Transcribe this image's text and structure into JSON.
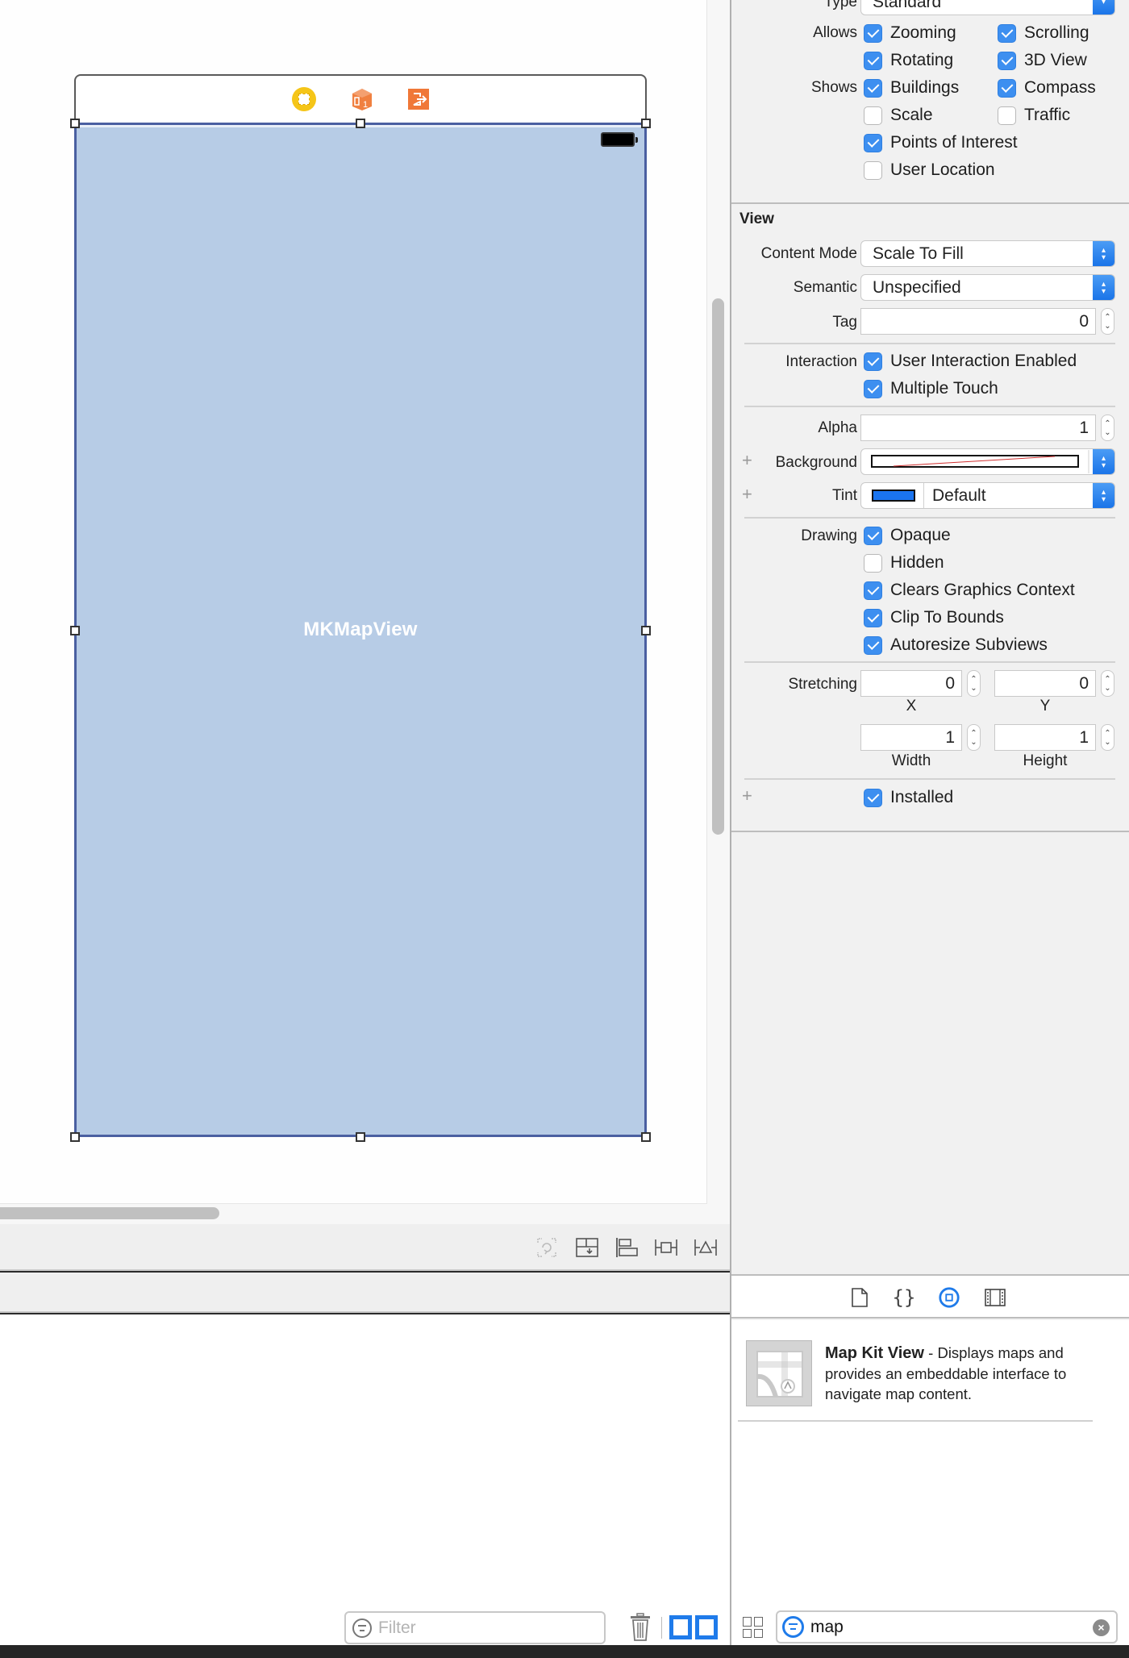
{
  "canvas": {
    "map_view_label": "MKMapView",
    "scene_icons": [
      "view-controller-icon",
      "first-responder-icon",
      "exit-icon"
    ],
    "map_fill_color": "#b7cce6",
    "selection_color": "#4a5fa1"
  },
  "canvas_toolbar": {
    "icons": [
      "update-frames-icon",
      "embed-in-stack-icon",
      "align-icon",
      "add-constraints-icon",
      "resolve-issues-icon"
    ]
  },
  "debug_bar": {
    "filter_placeholder": "Filter",
    "trash_icon": "trash-icon",
    "panel_toggles": [
      "show-variables-view",
      "show-console"
    ]
  },
  "inspector": {
    "map_view": {
      "type_label": "Type",
      "type_value": "Standard",
      "allows_label": "Allows",
      "shows_label": "Shows",
      "allows": [
        {
          "label": "Zooming",
          "checked": true
        },
        {
          "label": "Scrolling",
          "checked": true
        },
        {
          "label": "Rotating",
          "checked": true
        },
        {
          "label": "3D View",
          "checked": true
        }
      ],
      "shows": [
        {
          "label": "Buildings",
          "checked": true
        },
        {
          "label": "Compass",
          "checked": true
        },
        {
          "label": "Scale",
          "checked": false
        },
        {
          "label": "Traffic",
          "checked": false
        },
        {
          "label": "Points of Interest",
          "checked": true
        },
        {
          "label": "User Location",
          "checked": false
        }
      ]
    },
    "view": {
      "section_title": "View",
      "content_mode_label": "Content Mode",
      "content_mode_value": "Scale To Fill",
      "semantic_label": "Semantic",
      "semantic_value": "Unspecified",
      "tag_label": "Tag",
      "tag_value": "0",
      "interaction_label": "Interaction",
      "interaction": [
        {
          "label": "User Interaction Enabled",
          "checked": true
        },
        {
          "label": "Multiple Touch",
          "checked": true
        }
      ],
      "alpha_label": "Alpha",
      "alpha_value": "1",
      "background_label": "Background",
      "tint_label": "Tint",
      "tint_value": "Default",
      "tint_color": "#1a74f0",
      "drawing_label": "Drawing",
      "drawing": [
        {
          "label": "Opaque",
          "checked": true
        },
        {
          "label": "Hidden",
          "checked": false
        },
        {
          "label": "Clears Graphics Context",
          "checked": true
        },
        {
          "label": "Clip To Bounds",
          "checked": true
        },
        {
          "label": "Autoresize Subviews",
          "checked": true
        }
      ],
      "stretching_label": "Stretching",
      "stretching": {
        "x": "0",
        "x_label": "X",
        "y": "0",
        "y_label": "Y",
        "width": "1",
        "width_label": "Width",
        "height": "1",
        "height_label": "Height"
      },
      "installed_label": "Installed",
      "installed_checked": true
    }
  },
  "library": {
    "tabs": [
      {
        "name": "file-template-library",
        "active": false
      },
      {
        "name": "code-snippet-library",
        "active": false
      },
      {
        "name": "object-library",
        "active": true
      },
      {
        "name": "media-library",
        "active": false
      }
    ],
    "item": {
      "title": "Map Kit View",
      "separator": " - ",
      "description": "Displays maps and provides an embeddable interface to navigate map content."
    },
    "search_value": "map"
  }
}
